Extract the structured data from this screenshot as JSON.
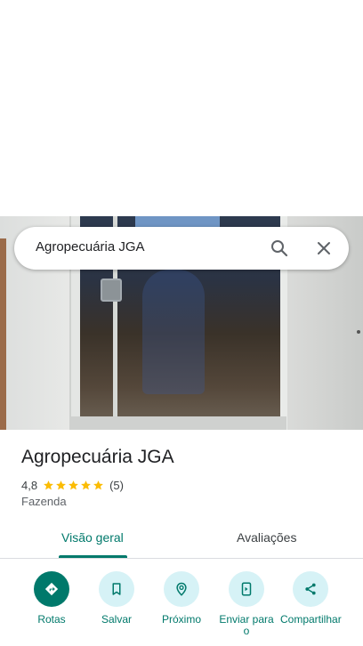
{
  "search": {
    "query": "Agropecuária JGA"
  },
  "icons": {
    "search": "search-icon",
    "close": "close-icon",
    "star": "star-icon",
    "directions": "directions-icon",
    "bookmark": "bookmark-icon",
    "nearby": "nearby-icon",
    "send": "send-to-phone-icon",
    "share": "share-icon"
  },
  "place": {
    "name": "Agropecuária JGA",
    "rating": "4,8",
    "stars": 5,
    "review_count": "(5)",
    "category": "Fazenda"
  },
  "tabs": [
    {
      "label": "Visão geral",
      "selected": true
    },
    {
      "label": "Avaliações",
      "selected": false
    }
  ],
  "actions": [
    {
      "label": "Rotas"
    },
    {
      "label": "Salvar"
    },
    {
      "label": "Próximo"
    },
    {
      "label": "Enviar para o"
    },
    {
      "label": "Compartilhar"
    }
  ],
  "colors": {
    "accent": "#00796b",
    "accent_light": "#d6f2f6",
    "star": "#fbbc04",
    "text": "#202124"
  }
}
